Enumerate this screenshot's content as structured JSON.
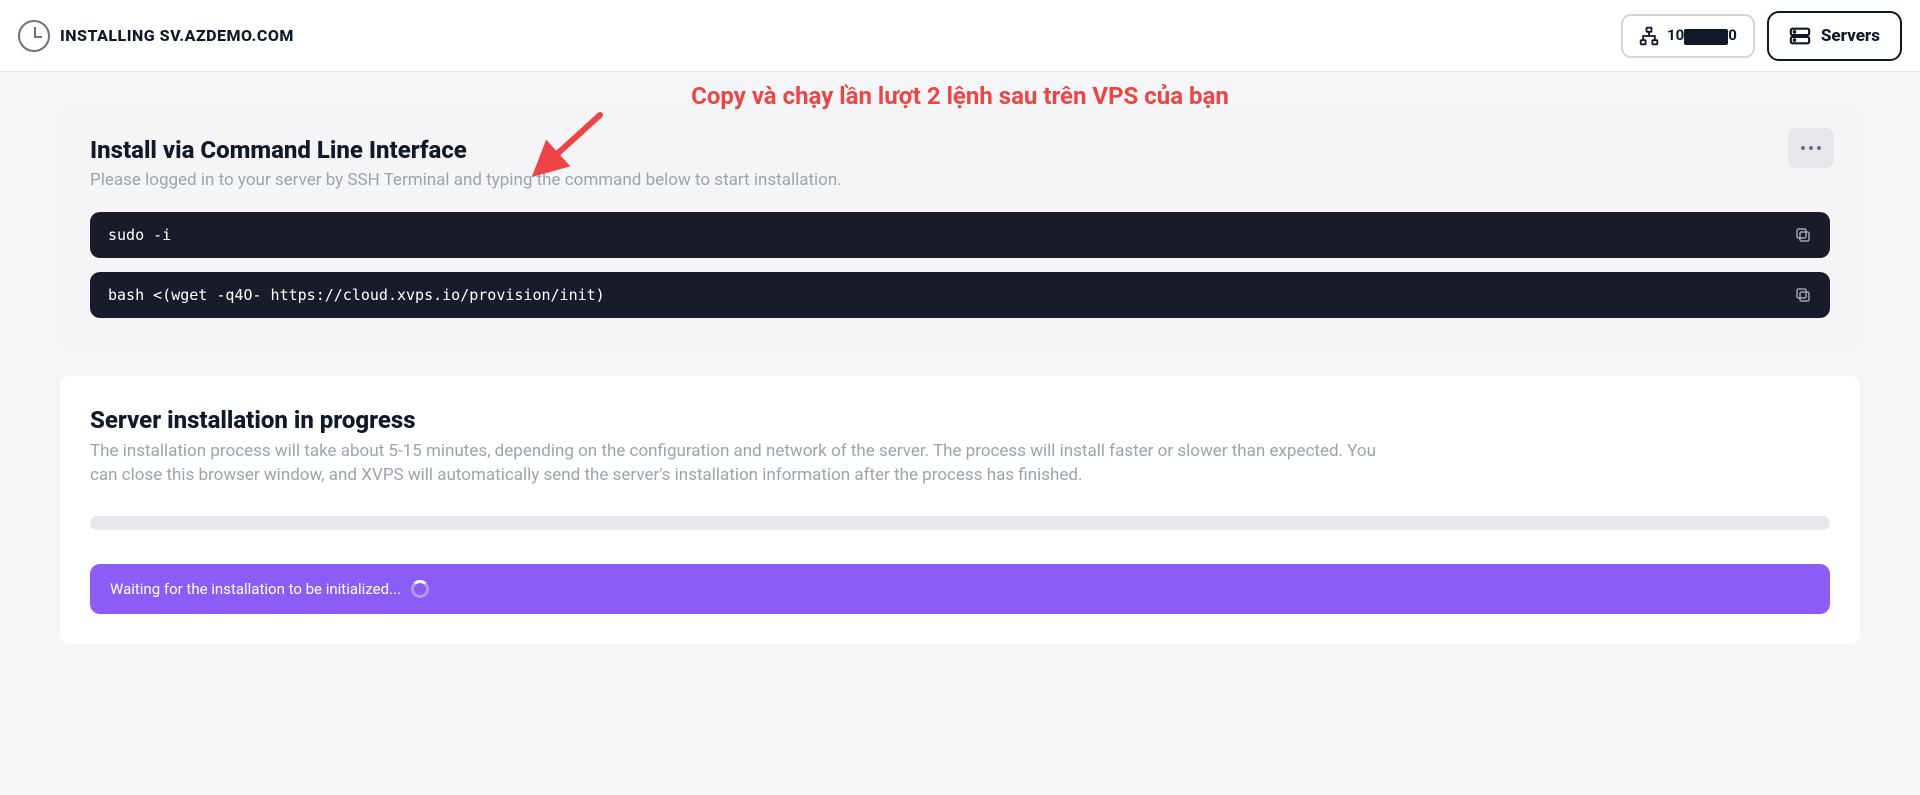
{
  "header": {
    "title": "INSTALLING SV.AZDEMO.COM",
    "ip_prefix": "10",
    "ip_suffix": "0",
    "servers_label": "Servers"
  },
  "annotation": {
    "text": "Copy và chạy lần lượt 2 lệnh sau trên VPS của bạn"
  },
  "cli_card": {
    "heading": "Install via Command Line Interface",
    "sub": "Please logged in to your server by SSH Terminal and typing the command below to start installation.",
    "commands": [
      "sudo -i",
      "bash <(wget -q4O- https://cloud.xvps.io/provision/init)"
    ]
  },
  "progress_card": {
    "heading": "Server installation in progress",
    "sub": "The installation process will take about 5-15 minutes, depending on the configuration and network of the server. The process will install faster or slower than expected. You can close this browser window, and XVPS will automatically send the server's installation information after the process has finished.",
    "status": "Waiting for the installation to be initialized..."
  }
}
